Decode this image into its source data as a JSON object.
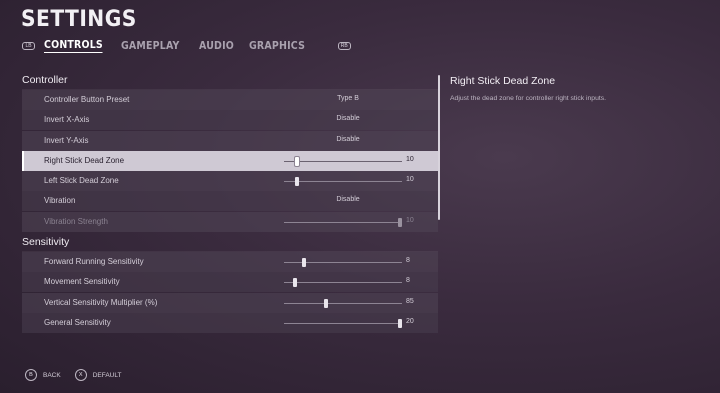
{
  "title": "SETTINGS",
  "tabs": {
    "left_bumper": "LB",
    "right_bumper": "RB",
    "items": [
      {
        "label": "CONTROLS",
        "active": true
      },
      {
        "label": "GAMEPLAY",
        "active": false
      },
      {
        "label": "AUDIO",
        "active": false
      },
      {
        "label": "GRAPHICS",
        "active": false
      }
    ]
  },
  "controller_section": {
    "title": "Controller",
    "rows": [
      {
        "label": "Controller Button Preset",
        "type": "select",
        "value": "Type B"
      },
      {
        "label": "Invert X-Axis",
        "type": "select",
        "value": "Disable"
      },
      {
        "label": "Invert Y-Axis",
        "type": "select",
        "value": "Disable"
      },
      {
        "label": "Right Stick Dead Zone",
        "type": "slider",
        "value": "10",
        "level": 0.1,
        "selected": true
      },
      {
        "label": "Left Stick Dead Zone",
        "type": "slider",
        "value": "10",
        "level": 0.1
      },
      {
        "label": "Vibration",
        "type": "select",
        "value": "Disable"
      },
      {
        "label": "Vibration Strength",
        "type": "slider",
        "value": "10",
        "level": 1.0,
        "disabled": true
      }
    ]
  },
  "sensitivity_section": {
    "title": "Sensitivity",
    "rows": [
      {
        "label": "Forward Running Sensitivity",
        "type": "slider",
        "value": "8",
        "level": 0.16
      },
      {
        "label": "Movement Sensitivity",
        "type": "slider",
        "value": "8",
        "level": 0.08
      },
      {
        "label": "Vertical Sensitivity Multiplier (%)",
        "type": "slider",
        "value": "85",
        "level": 0.35
      },
      {
        "label": "General Sensitivity",
        "type": "slider",
        "value": "20",
        "level": 1.0
      }
    ]
  },
  "info": {
    "title": "Right Stick Dead Zone",
    "description": "Adjust the dead zone for controller right stick inputs."
  },
  "footer": {
    "back": {
      "button": "B",
      "label": "BACK"
    },
    "default": {
      "button": "X",
      "label": "DEFAULT"
    }
  },
  "colors": {
    "background": "#3a2b3e",
    "selected_row": "#cfc9d4",
    "row": "#50465a",
    "text": "#e8e4ea"
  }
}
